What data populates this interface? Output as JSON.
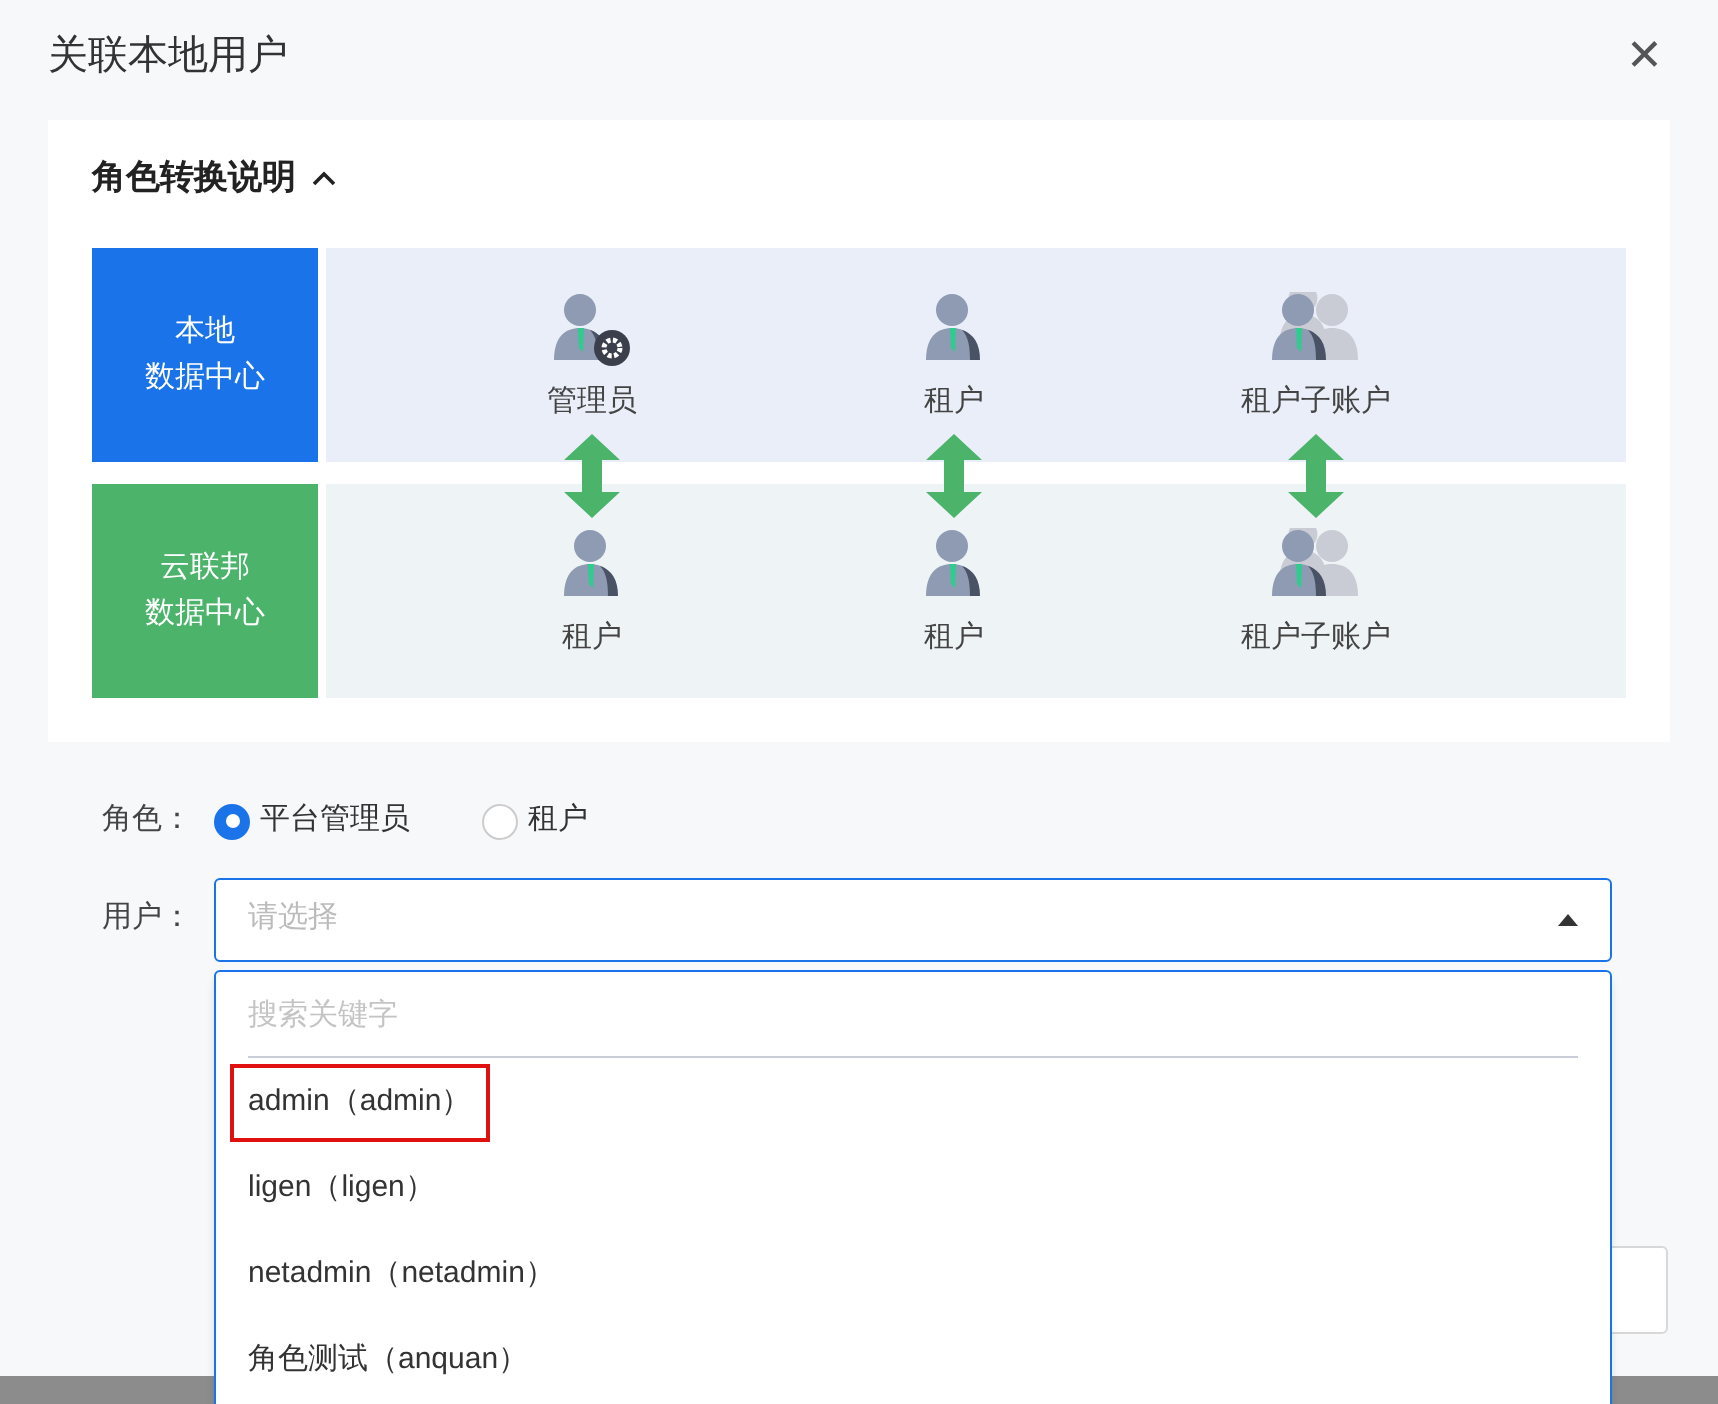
{
  "dialog": {
    "title": "关联本地用户",
    "close": "✕"
  },
  "explanation": {
    "title": "角色转换说明",
    "expanded": true,
    "rows": [
      {
        "kind": "local",
        "label": [
          "本地",
          "数据中心"
        ],
        "roles": [
          {
            "kind": "admin",
            "label": "管理员"
          },
          {
            "kind": "user",
            "label": "租户"
          },
          {
            "kind": "group",
            "label": "租户子账户"
          }
        ]
      },
      {
        "kind": "cloud",
        "label": [
          "云联邦",
          "数据中心"
        ],
        "roles": [
          {
            "kind": "user",
            "label": "租户"
          },
          {
            "kind": "user",
            "label": "租户"
          },
          {
            "kind": "group",
            "label": "租户子账户"
          }
        ]
      }
    ]
  },
  "form": {
    "role_label": "角色：",
    "roles": [
      {
        "label": "平台管理员",
        "selected": true
      },
      {
        "label": "租户",
        "selected": false
      }
    ],
    "user_label": "用户：",
    "user_select": {
      "placeholder": "请选择",
      "expanded": true
    }
  },
  "dropdown": {
    "search_placeholder": "搜索关键字",
    "options": [
      {
        "label": "admin（admin）",
        "highlighted": true
      },
      {
        "label": "ligen（ligen）",
        "highlighted": false
      },
      {
        "label": "netadmin（netadmin）",
        "highlighted": false
      },
      {
        "label": "角色测试（anquan）",
        "highlighted": false
      }
    ]
  }
}
